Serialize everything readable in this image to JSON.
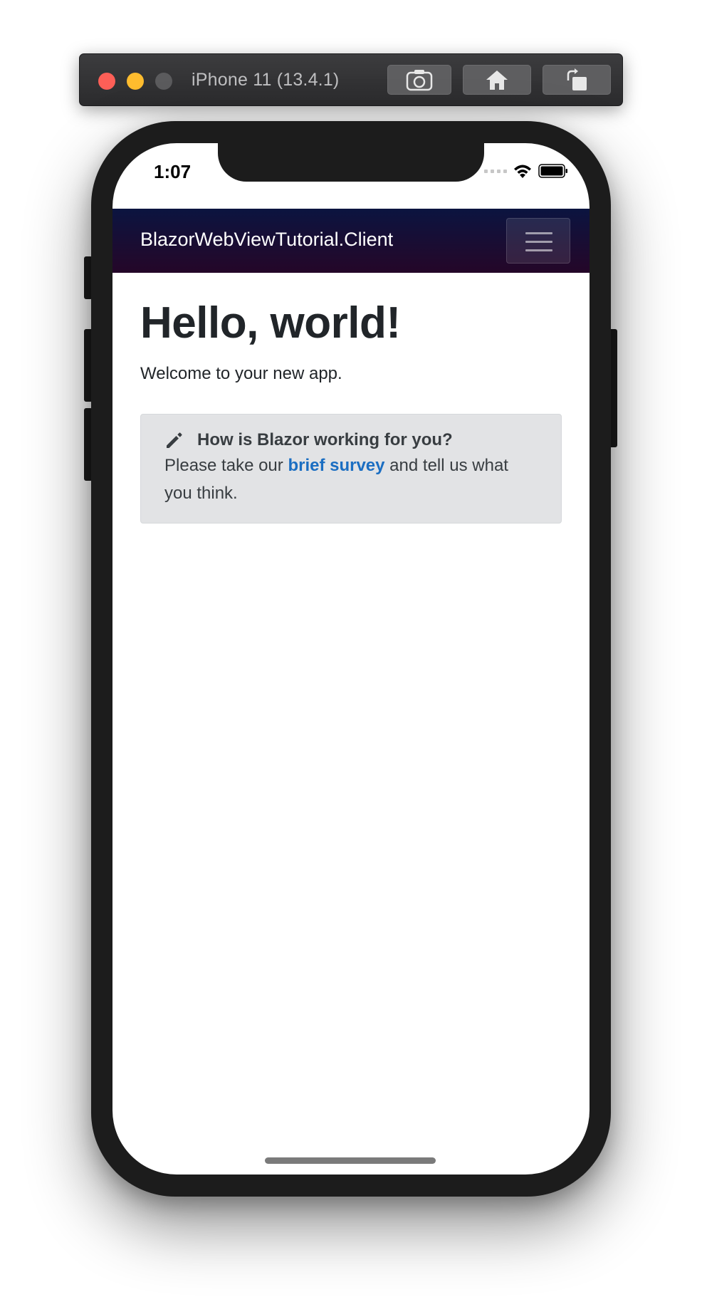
{
  "simulator": {
    "title": "iPhone 11 (13.4.1)",
    "buttons": [
      {
        "name": "screenshot",
        "icon": "camera-icon"
      },
      {
        "name": "home",
        "icon": "home-icon"
      },
      {
        "name": "rotate",
        "icon": "rotate-icon"
      }
    ]
  },
  "status_bar": {
    "time": "1:07",
    "icons": [
      "signal-dots-icon",
      "wifi-icon",
      "battery-icon"
    ]
  },
  "navbar": {
    "brand": "BlazorWebViewTutorial.Client",
    "toggler_icon": "hamburger-menu-icon",
    "gradient_top": "#0b1440",
    "gradient_bottom": "#240628"
  },
  "page": {
    "heading": "Hello, world!",
    "welcome": "Welcome to your new app."
  },
  "survey": {
    "icon": "pencil-icon",
    "title": "How is Blazor working for you?",
    "text_before": "Please take our ",
    "link_text": "brief survey",
    "text_after": " and tell us what you think.",
    "link_color": "#1b6ec2"
  }
}
